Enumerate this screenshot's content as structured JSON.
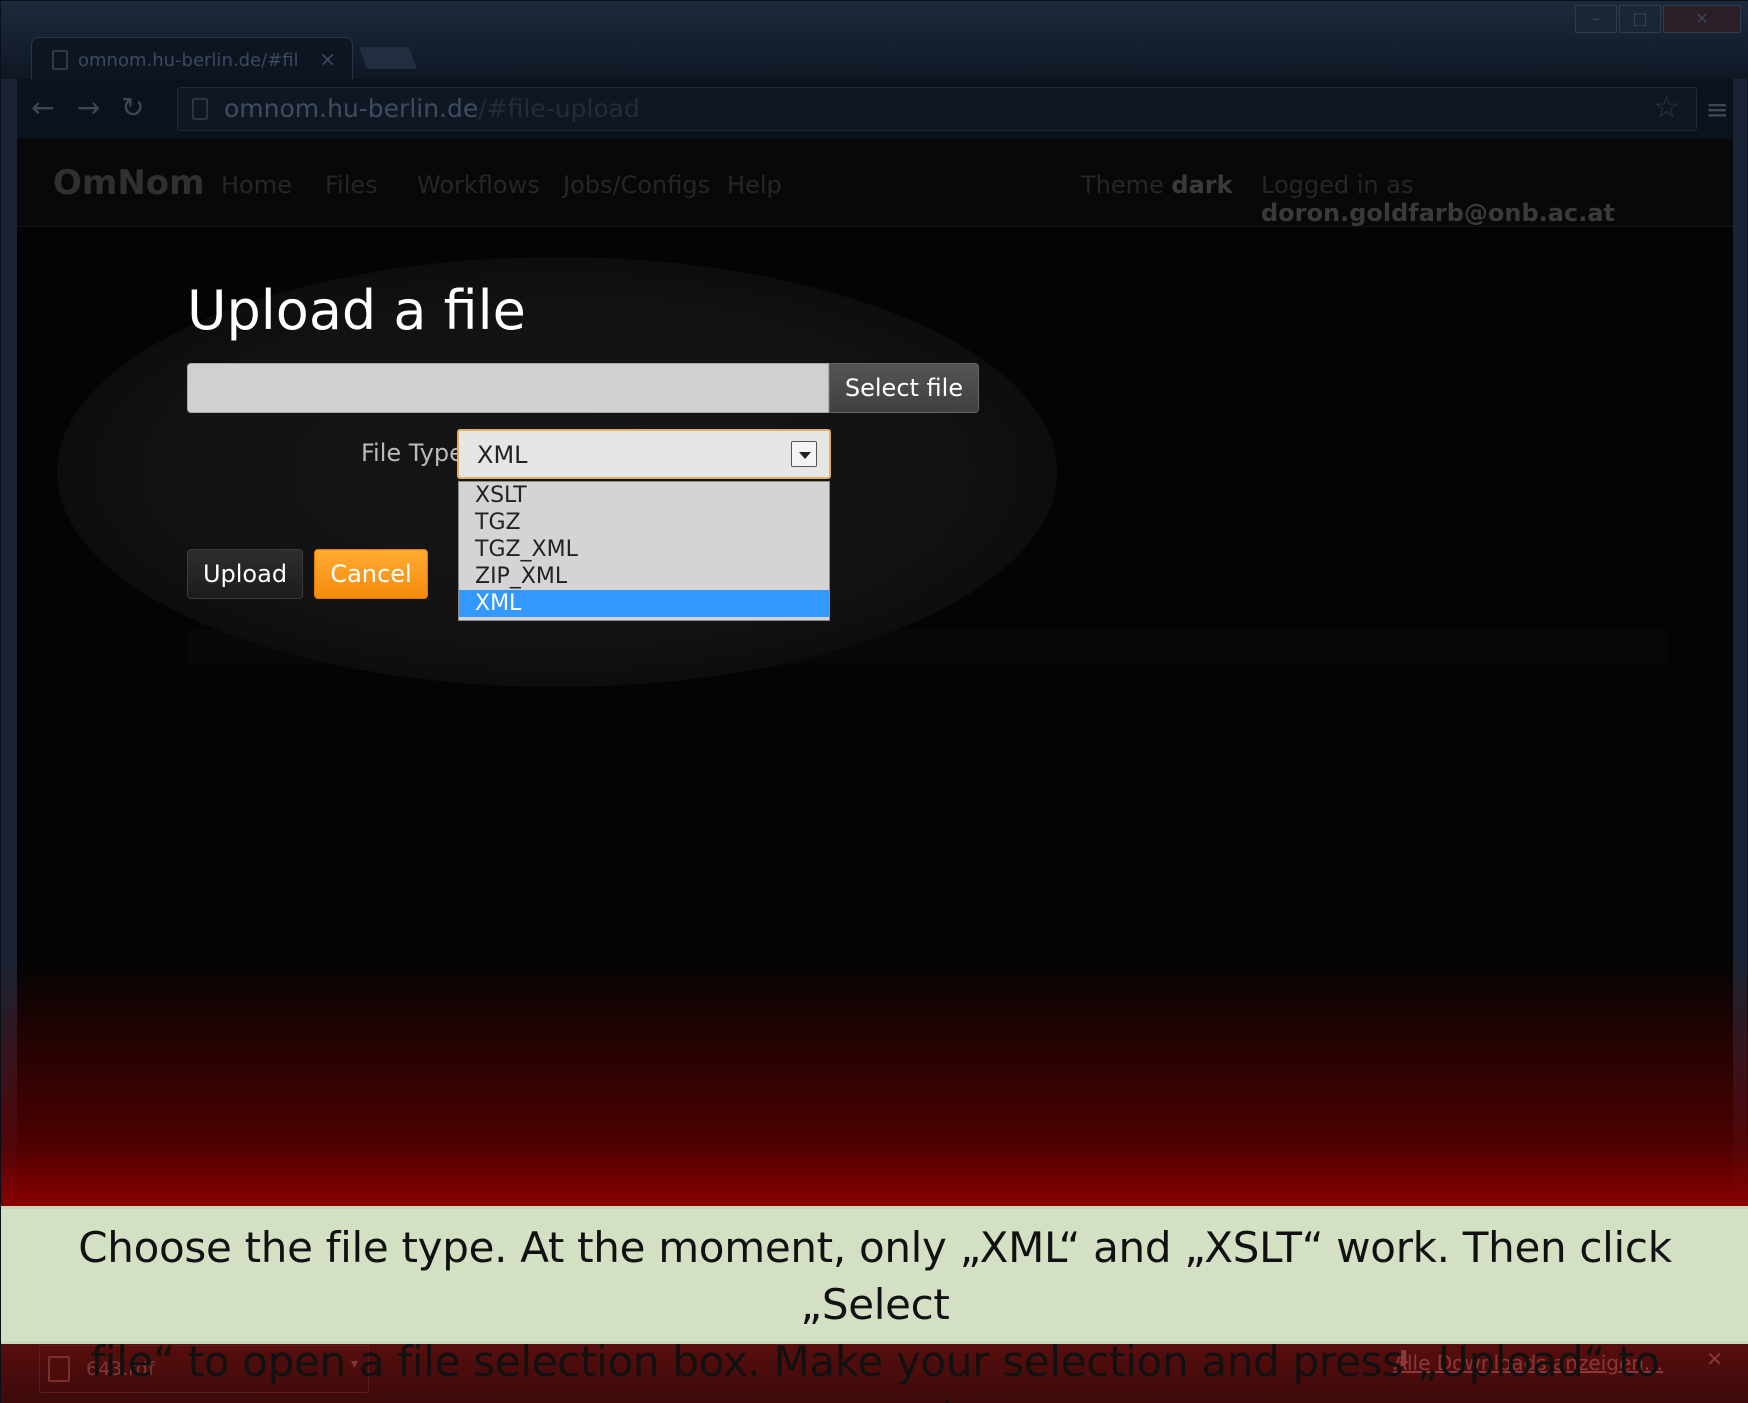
{
  "browser": {
    "tab_title": "omnom.hu-berlin.de/#fil",
    "url_domain": "omnom.hu-berlin.de",
    "url_path": "/#file-upload"
  },
  "navbar": {
    "brand": "OmNom",
    "links": [
      "Home",
      "Files",
      "Workflows",
      "Jobs/Configs",
      "Help"
    ],
    "theme_label": "Theme ",
    "theme_value": "dark",
    "login_label": "Logged in as ",
    "login_value": "doron.goldfarb@onb.ac.at"
  },
  "form": {
    "title": "Upload a file",
    "select_file_label": "Select file",
    "file_type_label": "File Type",
    "selected_type": "XML",
    "options": [
      "XSLT",
      "TGZ",
      "TGZ_XML",
      "ZIP_XML",
      "XML"
    ],
    "upload_label": "Upload",
    "cancel_label": "Cancel"
  },
  "downloads": {
    "file_name": "643.rdf",
    "show_all": "Alle Downloads anzeigen..."
  },
  "caption": {
    "line1": "Choose the file type. At the moment, only „XML“ and „XSLT“ work. Then click „Select",
    "line2": "file“ to open a file selection box. Make your selection and press „Upload“ to proceed."
  },
  "colors": {
    "accent_orange": "#f7941d",
    "selection_blue": "#3399ff",
    "caption_bg": "#d4e0c3"
  }
}
